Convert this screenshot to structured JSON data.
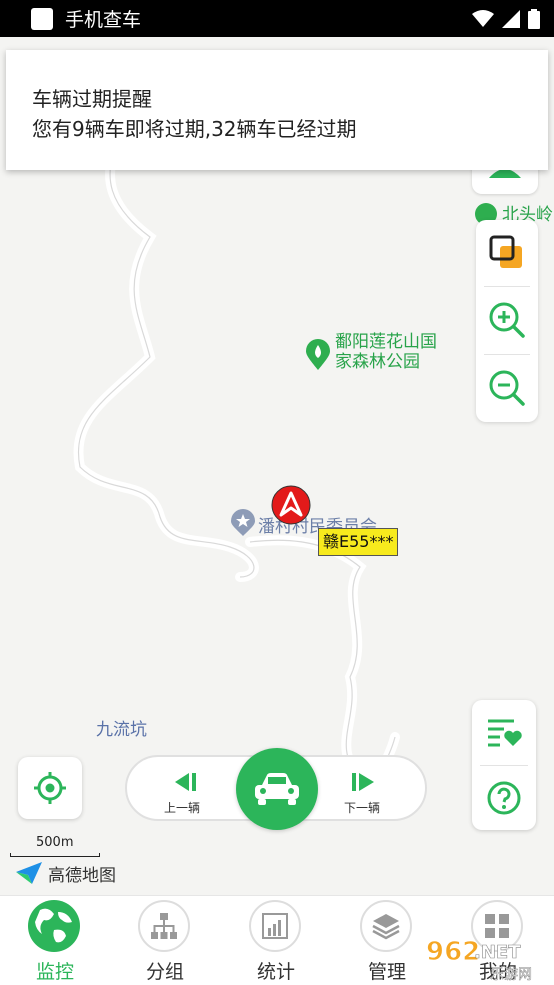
{
  "status_bar": {
    "title": "手机查车"
  },
  "notification": {
    "heading": "车辆过期提醒",
    "message": "您有9辆车即将过期,32辆车已经过期"
  },
  "map": {
    "pois": [
      {
        "label_line1": "鄱阳莲花山国",
        "label_line2": "家森林公园"
      },
      {
        "label": "潘村村民委员会"
      },
      {
        "label": "九流坑"
      },
      {
        "label": "北头岭"
      }
    ],
    "vehicle": {
      "plate": "赣E55***"
    },
    "scale": "500m",
    "provider": "高德地图"
  },
  "controls": {
    "prev_label": "上一辆",
    "next_label": "下一辆"
  },
  "tabs": [
    {
      "label": "监控",
      "icon": "globe-icon",
      "active": true
    },
    {
      "label": "分组",
      "icon": "hierarchy-icon",
      "active": false
    },
    {
      "label": "统计",
      "icon": "bar-chart-icon",
      "active": false
    },
    {
      "label": "管理",
      "icon": "layers-icon",
      "active": false
    },
    {
      "label": "我的",
      "icon": "grid-icon",
      "active": false
    }
  ],
  "watermark": {
    "text1": "962",
    "text2": ".NET",
    "text3": "乐游网"
  },
  "colors": {
    "accent": "#2cb55a",
    "plate_bg": "#f7ea1d",
    "marker": "#e31a1a"
  }
}
